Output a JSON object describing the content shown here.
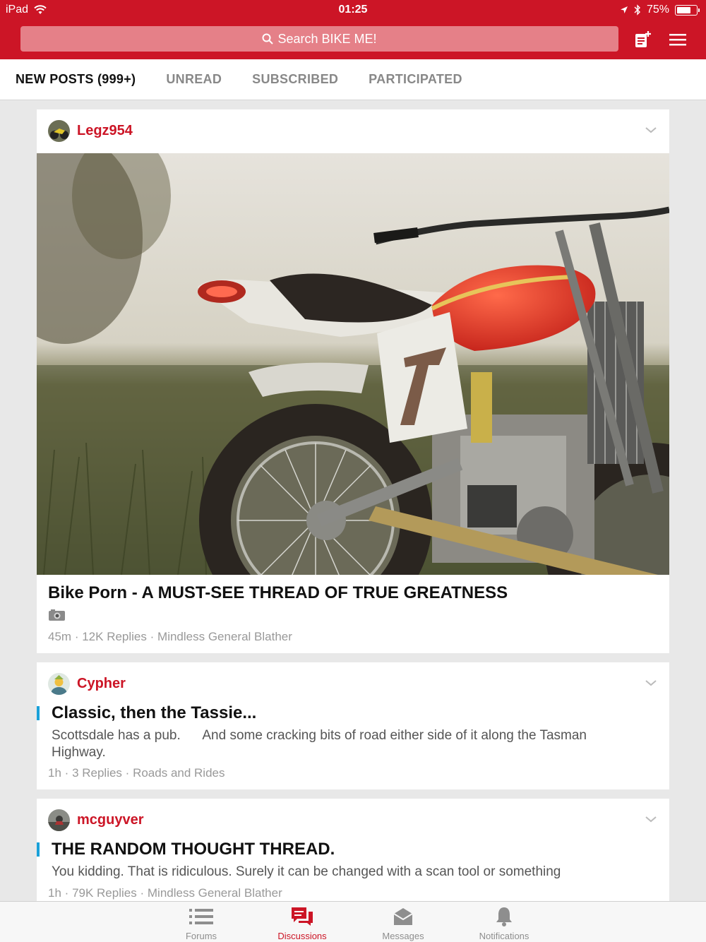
{
  "status_bar": {
    "device": "iPad",
    "time": "01:25",
    "battery": "75%",
    "battery_level": 0.75
  },
  "header": {
    "search_placeholder": "Search BIKE ME!",
    "compose_icon": "new-post-icon",
    "menu_icon": "hamburger-icon"
  },
  "tabs": [
    {
      "label": "NEW POSTS (999+)"
    },
    {
      "label": "UNREAD"
    },
    {
      "label": "SUBSCRIBED"
    },
    {
      "label": "PARTICIPATED"
    }
  ],
  "posts": [
    {
      "username": "Legz954",
      "title": "Bike Porn - A MUST-SEE THREAD OF TRUE GREATNESS",
      "attachment_icon": "camera-icon",
      "time": "45m",
      "replies": "12K Replies",
      "forum": "Mindless General Blather"
    },
    {
      "username": "Cypher",
      "title": "Classic, then the Tassie...",
      "preview": "Scottsdale has a pub.      And some cracking bits of road either side of it along the Tasman Highway.",
      "time": "1h",
      "replies": "3 Replies",
      "forum": "Roads and Rides"
    },
    {
      "username": "mcguyver",
      "title": "THE RANDOM THOUGHT THREAD.",
      "preview": "You kidding. That is ridiculous. Surely it can be changed with a scan tool or something",
      "time": "1h",
      "replies": "79K Replies",
      "forum": "Mindless General Blather"
    }
  ],
  "meta_separator": "·",
  "bottom_nav": [
    {
      "label": "Forums",
      "icon": "list-icon"
    },
    {
      "label": "Discussions",
      "icon": "discussions-icon"
    },
    {
      "label": "Messages",
      "icon": "envelope-icon"
    },
    {
      "label": "Notifications",
      "icon": "bell-icon"
    }
  ],
  "colors": {
    "brand_red": "#cc1526",
    "accent_blue": "#1aa1d9",
    "meta_gray": "#999999"
  }
}
